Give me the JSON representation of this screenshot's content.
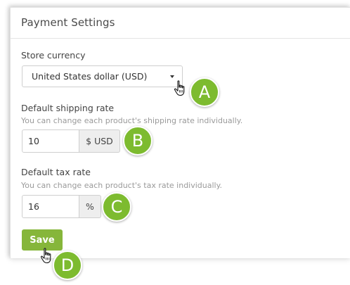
{
  "panel": {
    "title": "Payment Settings"
  },
  "currency": {
    "label": "Store currency",
    "selected": "United States dollar (USD)"
  },
  "shipping": {
    "label": "Default shipping rate",
    "hint": "You can change each product's shipping rate individually.",
    "value": "10",
    "unit": "$ USD"
  },
  "tax": {
    "label": "Default tax rate",
    "hint": "You can change each product's tax rate individually.",
    "value": "16",
    "unit": "%"
  },
  "actions": {
    "save_label": "Save"
  },
  "callouts": {
    "a": "A",
    "b": "B",
    "c": "C",
    "d": "D"
  },
  "icons": {
    "cursor": "hand-pointer-icon",
    "caret": "chevron-down-icon"
  },
  "colors": {
    "accent_green": "#86b63a",
    "badge_green": "#7dbb2f"
  }
}
